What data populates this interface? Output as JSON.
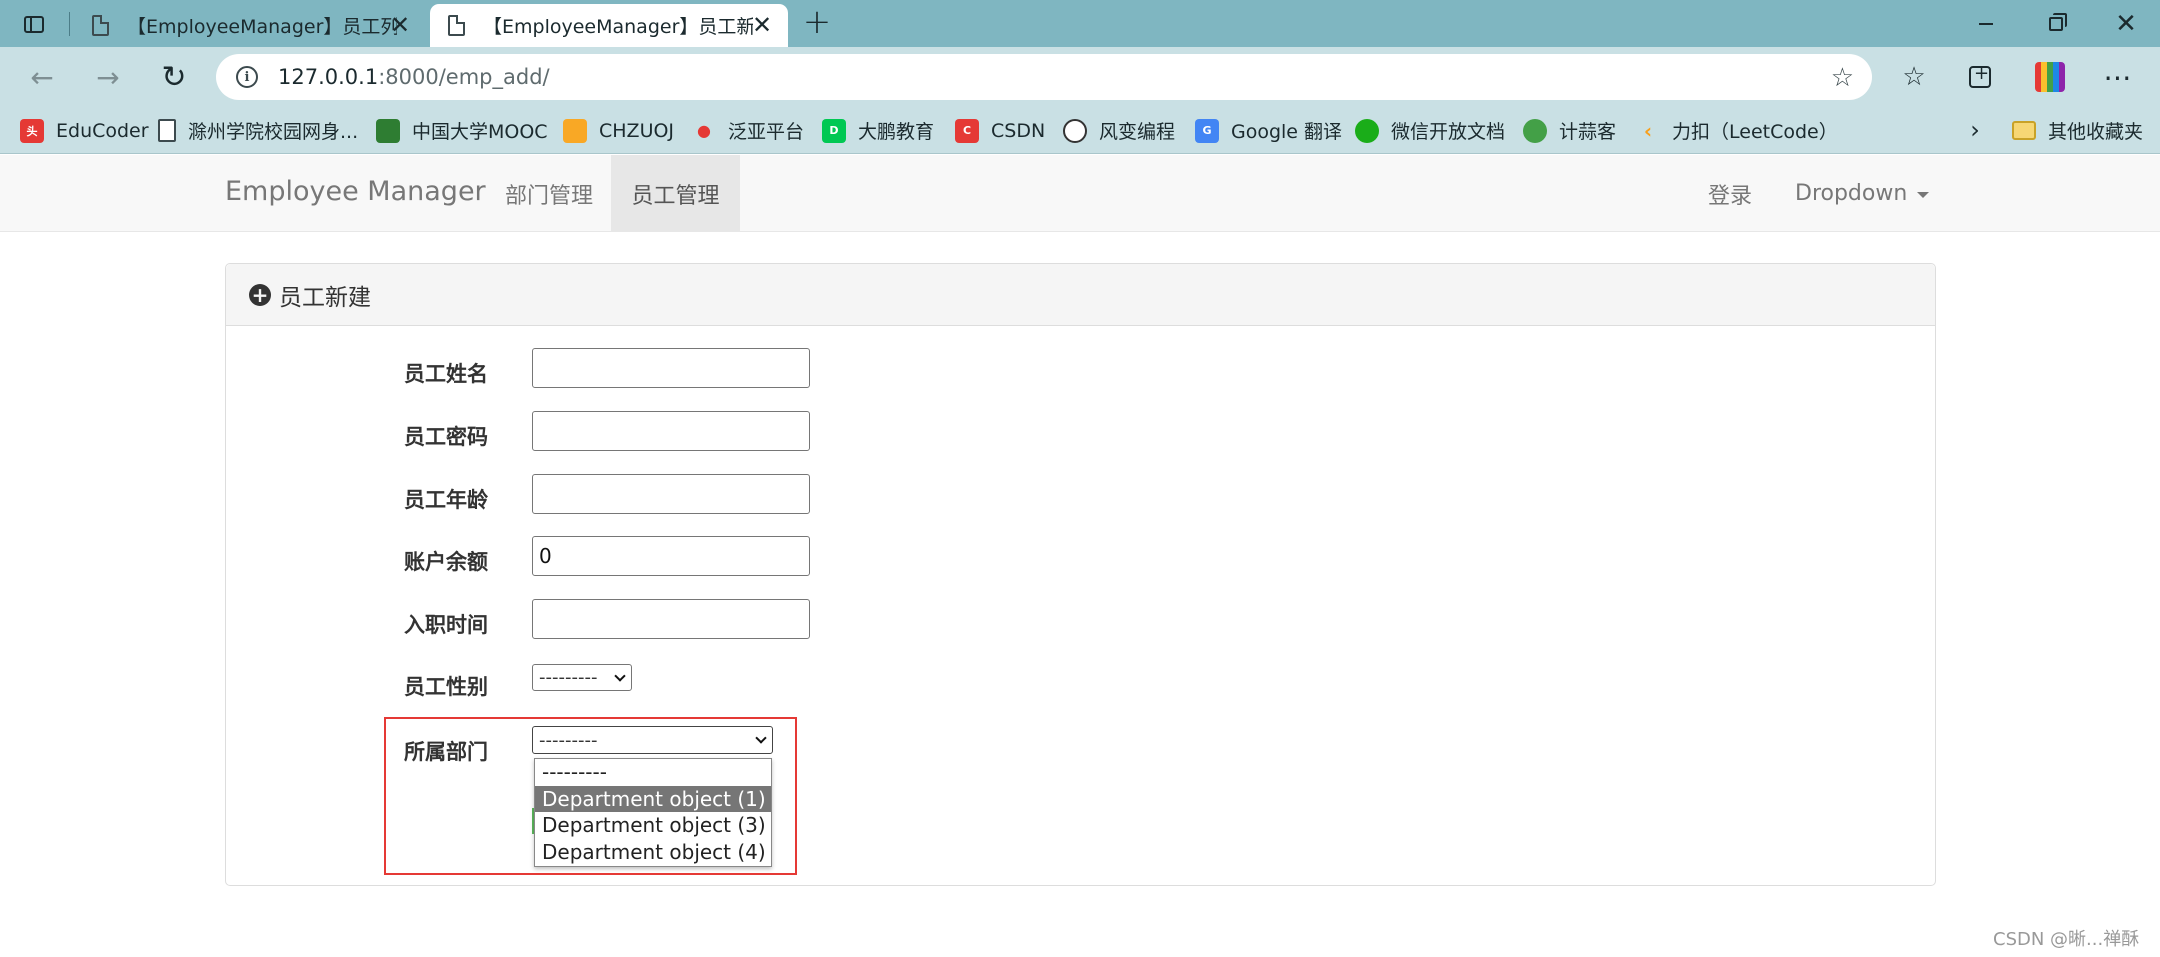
{
  "browser": {
    "tabs": [
      {
        "title": "【EmployeeManager】员工列表",
        "active": false
      },
      {
        "title": "【EmployeeManager】员工新建",
        "active": true
      }
    ],
    "url_host": "127.0.0.1",
    "url_rest": ":8000/emp_add/",
    "bookmarks": [
      {
        "label": "EduCoder",
        "icon": "toutiao-icon",
        "color": "#e53935"
      },
      {
        "label": "滁州学院校园网身...",
        "icon": "page-icon",
        "color": "#ffffff"
      },
      {
        "label": "中国大学MOOC",
        "icon": "mooc-icon",
        "color": "#2e7d32"
      },
      {
        "label": "CHZUOJ",
        "icon": "chzuoj-icon",
        "color": "#f9a825"
      },
      {
        "label": "泛亚平台",
        "icon": "fanya-icon",
        "color": "#e53935"
      },
      {
        "label": "大鹏教育",
        "icon": "dapeng-icon",
        "color": "#00c853"
      },
      {
        "label": "CSDN",
        "icon": "csdn-icon",
        "color": "#e53935"
      },
      {
        "label": "风变编程",
        "icon": "panda-icon",
        "color": "#333333"
      },
      {
        "label": "Google 翻译",
        "icon": "google-translate-icon",
        "color": "#4285f4"
      },
      {
        "label": "微信开放文档",
        "icon": "wechat-icon",
        "color": "#1aad19"
      },
      {
        "label": "计蒜客",
        "icon": "jisuanke-icon",
        "color": "#43a047"
      },
      {
        "label": "力扣（LeetCode）",
        "icon": "leetcode-icon",
        "color": "#f89f1b"
      }
    ],
    "other_bookmarks": "其他收藏夹"
  },
  "navbar": {
    "brand": "Employee Manager",
    "items": [
      "部门管理",
      "员工管理"
    ],
    "active_item": "员工管理",
    "login": "登录",
    "dropdown": "Dropdown"
  },
  "panel": {
    "title": "员工新建",
    "fields": [
      {
        "label": "员工姓名",
        "value": ""
      },
      {
        "label": "员工密码",
        "value": ""
      },
      {
        "label": "员工年龄",
        "value": ""
      },
      {
        "label": "账户余额",
        "value": "0"
      },
      {
        "label": "入职时间",
        "value": ""
      }
    ],
    "gender": {
      "label": "员工性别",
      "value": "---------"
    },
    "department": {
      "label": "所属部门",
      "value": "---------",
      "options": [
        "---------",
        "Department object (1)",
        "Department object (3)",
        "Department object (4)"
      ],
      "highlighted": "Department object (1)"
    }
  },
  "watermark": "CSDN @晰...禅酥",
  "colors": {
    "tabbar": "#7fb6c1",
    "toolbar": "#c9e0e4",
    "highlight_box": "#e53935"
  }
}
